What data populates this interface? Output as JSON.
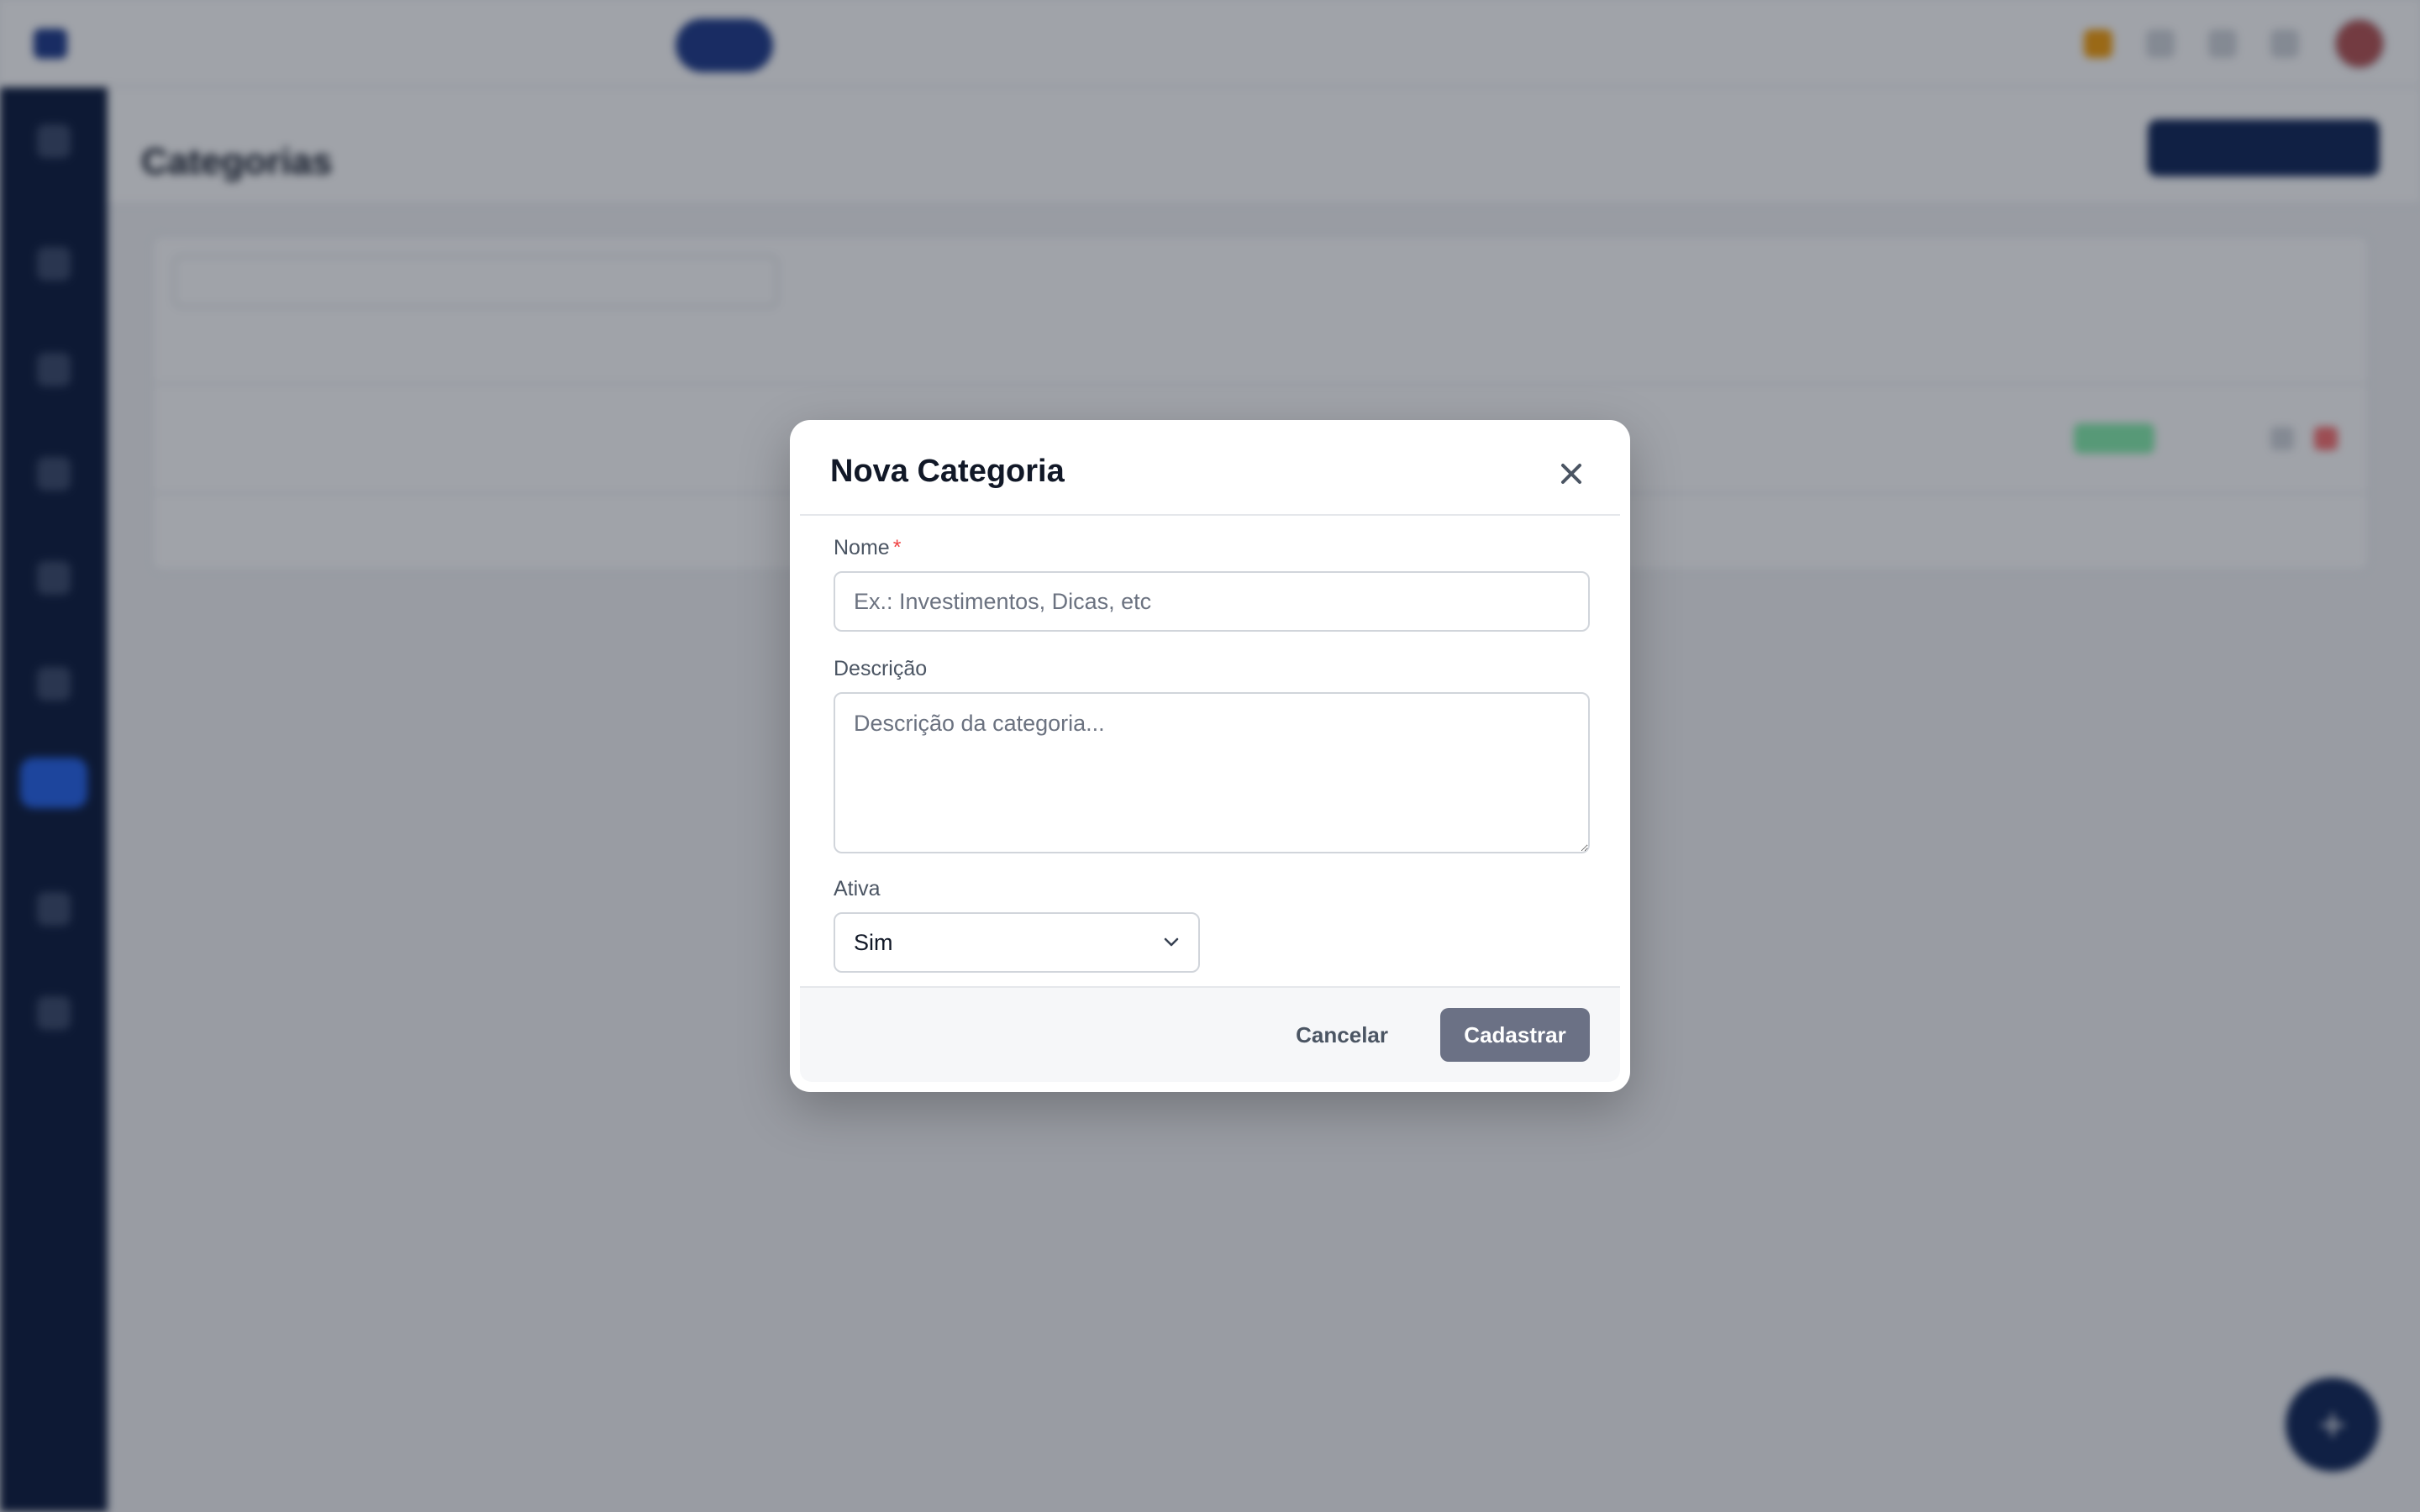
{
  "app": {
    "logo_text": "",
    "nav": [],
    "page": {
      "breadcrumb": "",
      "title": "Categorias",
      "new_button": ""
    },
    "table": {
      "search_placeholder": "",
      "columns": [],
      "rows": [
        {
          "name": "",
          "status": ""
        }
      ],
      "footer_left": "",
      "footer_right": ""
    }
  },
  "modal": {
    "title": "Nova Categoria",
    "fields": {
      "name": {
        "label": "Nome",
        "required_mark": "*",
        "value": "",
        "placeholder": "Ex.: Investimentos, Dicas, etc"
      },
      "description": {
        "label": "Descrição",
        "value": "",
        "placeholder": "Descrição da categoria..."
      },
      "active": {
        "label": "Ativa",
        "selected": "Sim"
      }
    },
    "buttons": {
      "cancel": "Cancelar",
      "submit": "Cadastrar"
    }
  },
  "colors": {
    "sidebar_bg": "#0b1a3d",
    "primary": "#0f2557",
    "submit_button": "#6b7185",
    "required": "#ef4444"
  }
}
